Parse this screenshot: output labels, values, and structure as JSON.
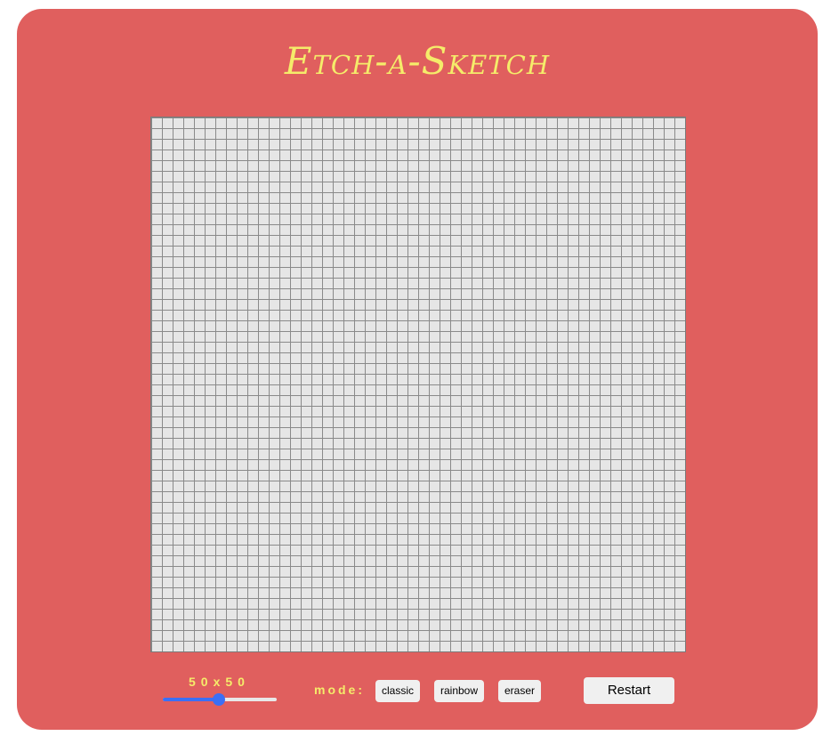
{
  "app": {
    "title": "Etch-a-Sketch"
  },
  "board": {
    "grid_cols": 50,
    "grid_rows": 50,
    "cell_color": "#e6e6e6",
    "line_color": "#8a8a8a"
  },
  "controls": {
    "size_label": "50x50",
    "size_slider": {
      "value": 50,
      "min": 1,
      "max": 100
    },
    "mode_label": "mode:",
    "modes": [
      {
        "label": "classic"
      },
      {
        "label": "rainbow"
      },
      {
        "label": "eraser"
      }
    ],
    "restart_label": "Restart"
  },
  "colors": {
    "background": "#e05f5e",
    "accent_text": "#f5ec6a",
    "slider_accent": "#3b6ff5",
    "button_bg": "#f0f0f0"
  }
}
